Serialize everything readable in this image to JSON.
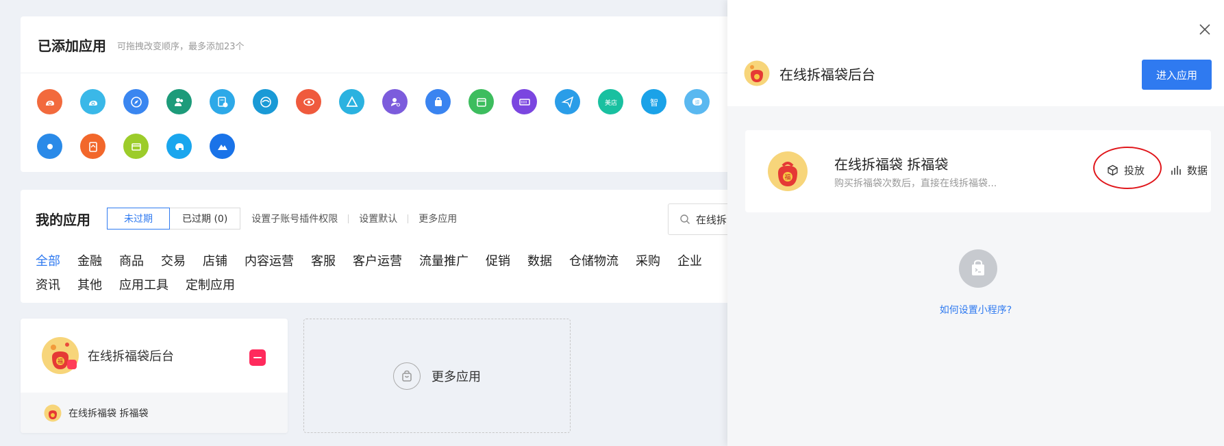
{
  "added_apps": {
    "title": "已添加应用",
    "hint": "可拖拽改变顺序，最多添加23个",
    "icons": [
      {
        "name": "snail-orange-icon",
        "color": "#f26a3d"
      },
      {
        "name": "snail-cyan-icon",
        "color": "#3ab8e8"
      },
      {
        "name": "compass-icon",
        "color": "#3a86f0"
      },
      {
        "name": "users-icon",
        "color": "#1d9b7a"
      },
      {
        "name": "document-clock-icon",
        "color": "#2da9e8"
      },
      {
        "name": "swirl-icon",
        "color": "#1a9ad6"
      },
      {
        "name": "eye-icon",
        "color": "#ef5a3d"
      },
      {
        "name": "triangle-icon",
        "color": "#2bb2e0"
      },
      {
        "name": "user-gear-icon",
        "color": "#7c5cdc"
      },
      {
        "name": "shopping-bag-icon",
        "color": "#3a84f0"
      },
      {
        "name": "calendar-icon",
        "color": "#3dbd5e"
      },
      {
        "name": "ticket-icon",
        "color": "#7b46e0"
      },
      {
        "name": "paper-plane-icon",
        "color": "#2a9de8"
      },
      {
        "name": "meidian-icon",
        "color": "#19c0a0"
      },
      {
        "name": "zhi-icon",
        "color": "#1aa2e8"
      },
      {
        "name": "review-icon",
        "color": "#5ab8f0"
      },
      {
        "name": "blue-partial-icon",
        "color": "#2a8ae8"
      },
      {
        "name": "coupon-tag-icon",
        "color": "#f2672b"
      },
      {
        "name": "store-icon",
        "color": "#9ccc2a"
      },
      {
        "name": "elephant-icon",
        "color": "#1aa6ee"
      },
      {
        "name": "mountain-icon",
        "color": "#1a73e8"
      }
    ]
  },
  "my_apps": {
    "title": "我的应用",
    "tabs": [
      "未过期",
      "已过期 (0)"
    ],
    "links": [
      "设置子账号插件权限",
      "设置默认",
      "更多应用"
    ],
    "search_value": "在线拆",
    "categories": [
      "全部",
      "金融",
      "商品",
      "交易",
      "店铺",
      "内容运营",
      "客服",
      "客户运营",
      "流量推广",
      "促销",
      "数据",
      "仓储物流",
      "采购",
      "企业",
      "资讯",
      "其他",
      "应用工具",
      "定制应用"
    ]
  },
  "app_card": {
    "name": "在线拆福袋后台",
    "sub_item": "在线拆福袋 拆福袋"
  },
  "more_card": {
    "label": "更多应用"
  },
  "drawer": {
    "app_name": "在线拆福袋后台",
    "enter_button": "进入应用",
    "plugin": {
      "title": "在线拆福袋 拆福袋",
      "desc": "购买拆福袋次数后，直接在线拆福袋...",
      "deploy": "投放",
      "data": "数据"
    },
    "howto_link": "如何设置小程序?"
  }
}
